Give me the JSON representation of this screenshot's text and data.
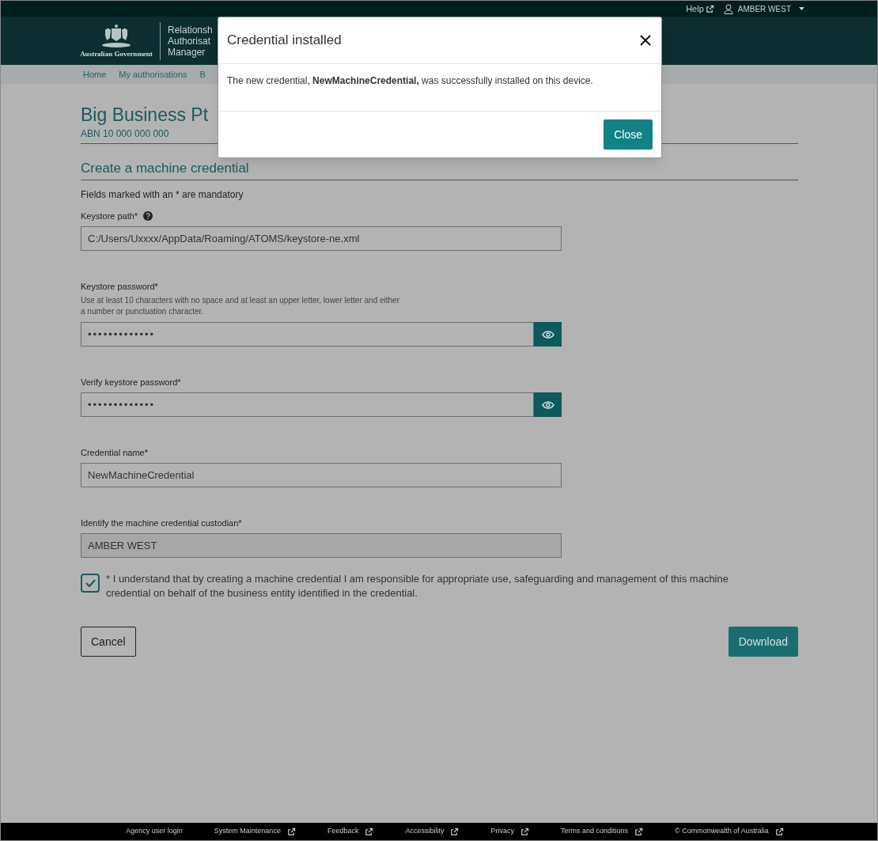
{
  "top_bar": {
    "help_link": "Help",
    "user_menu": "AMBER WEST"
  },
  "header": {
    "logo_caption": "Australian Government",
    "app_title_lines": [
      "Relationsh",
      "Authorisat",
      "Manager"
    ]
  },
  "nav": {
    "items": [
      {
        "label": "Home"
      },
      {
        "label": "My authorisations"
      },
      {
        "label": "B"
      }
    ]
  },
  "business": {
    "name": "Big Business Pt",
    "abn": "ABN 10 000 000 000"
  },
  "form": {
    "heading": "Create a machine credential",
    "mandatory_note": "Fields marked with an * are mandatory",
    "fields": [
      {
        "kind": "text",
        "label": "Keystore path*",
        "help_icon": true,
        "value": "C:/Users/Uxxxx/AppData/Roaming/ATOMS/keystore-ne.xml",
        "disabled": false
      },
      {
        "kind": "password",
        "label": "Keystore password*",
        "hint": "Use at least 10 characters with no space and at least an upper letter, lower letter and either a number or punctuation character.",
        "value": "•••••••••••••",
        "disabled": false
      },
      {
        "kind": "password",
        "label": "Verify keystore password*",
        "value": "•••••••••••••",
        "disabled": false
      },
      {
        "kind": "text",
        "label": "Credential name*",
        "value": "NewMachineCredential",
        "disabled": false
      },
      {
        "kind": "text",
        "label": "Identify the machine credential custodian*",
        "value": "AMBER WEST",
        "disabled": true
      }
    ],
    "consent": {
      "checked": true,
      "text": "* I understand that by creating a machine credential I am responsible for appropriate use, safeguarding and management of this machine credential on behalf of the business entity identified in the credential."
    },
    "buttons": {
      "cancel": "Cancel",
      "download": "Download"
    }
  },
  "modal": {
    "title": "Credential installed",
    "message": "The new credential, **NewMachineCredential,** was successfully installed on this device.",
    "close_button": "Close"
  },
  "footer": {
    "links": [
      {
        "label": "Agency user login",
        "external": false
      },
      {
        "label": "System Maintenance",
        "external": true
      },
      {
        "label": "Feedback",
        "external": true
      },
      {
        "label": "Accessibility",
        "external": true
      },
      {
        "label": "Privacy",
        "external": true
      },
      {
        "label": "Terms and conditions",
        "external": true
      },
      {
        "label": "© Commonwealth of Australia",
        "external": true
      }
    ]
  }
}
